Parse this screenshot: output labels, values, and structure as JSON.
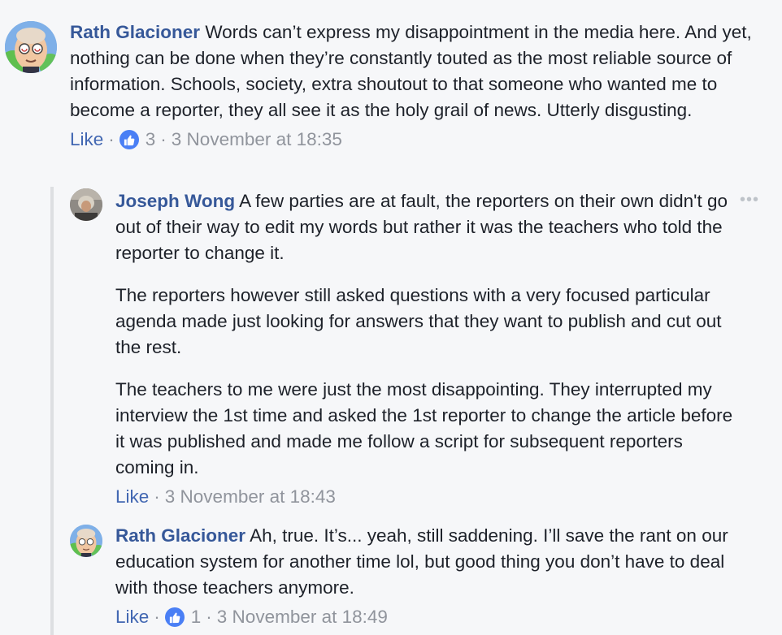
{
  "comments": [
    {
      "author": "Rath Glacioner",
      "avatar_icon": "rath-avatar",
      "text": "Words can’t express my disappointment in the media here. And yet, nothing can be done when they’re constantly touted as the most reliable source of information. Schools, society, extra shoutout to that someone who wanted me to become a reporter, they all see it as the holy grail of news. Utterly disgusting.",
      "like_label": "Like",
      "reaction_count": "3",
      "timestamp": "3 November at 18:35"
    }
  ],
  "replies": [
    {
      "author": "Joseph Wong",
      "avatar_icon": "joseph-avatar",
      "paragraphs": [
        "A few parties are at fault, the reporters on their own didn't go out of their way to edit my words but rather it was the teachers who told the reporter to change it.",
        "The reporters however still asked questions with a very focused particular agenda made just looking for answers that they want to publish and cut out the rest.",
        "The teachers to me were just the most disappointing. They interrupted my interview the 1st time and asked the 1st reporter to change the article before it was published and made me follow a script for subsequent reporters coming in."
      ],
      "like_label": "Like",
      "timestamp": "3 November at 18:43",
      "more_label": "•••"
    },
    {
      "author": "Rath Glacioner",
      "avatar_icon": "rath-avatar",
      "text": "Ah, true. It’s... yeah, still saddening. I’ll save the rant on our education system for another time lol, but good thing you don’t have to deal with those teachers anymore.",
      "like_label": "Like",
      "reaction_count": "1",
      "timestamp": "3 November at 18:49"
    }
  ],
  "separator": "·",
  "colors": {
    "background": "#f6f7f9",
    "author": "#365899",
    "like_link": "#4267b2",
    "meta": "#90949c",
    "like_badge": "#4a7ff5",
    "thread_line": "#dddfe2"
  }
}
